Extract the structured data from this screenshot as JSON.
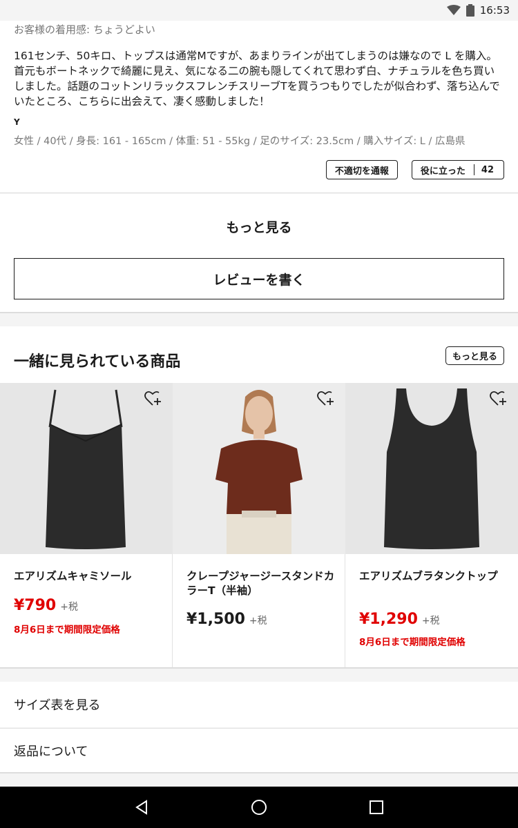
{
  "status_bar": {
    "time": "16:53"
  },
  "review": {
    "fit_label": "お客様の着用感: ちょうどよい",
    "body": "161センチ、50キロ、トップスは通常Mですが、あまりラインが出てしまうのは嫌なので L を購入。首元もボートネックで綺麗に見え、気になる二の腕も隠してくれて思わず白、ナチュラルを色ち買いしました。話題のコットンリラックスフレンチスリーブTを買うつもりでしたが似合わず、落ち込んでいたところ、こちらに出会えて、凄く感動しました！",
    "author": "Y",
    "meta": "女性 / 40代 / 身長: 161 - 165cm / 体重: 51 - 55kg / 足のサイズ: 23.5cm / 購入サイズ: L / 広島県",
    "report_label": "不適切を通報",
    "helpful_label": "役に立った",
    "helpful_count": "42"
  },
  "reviews_footer": {
    "more_label": "もっと見る",
    "write_review_label": "レビューを書く"
  },
  "related": {
    "title": "一緒に見られている商品",
    "more_label": "もっと見る",
    "products": [
      {
        "name": "エアリズムキャミソール",
        "price": "¥790",
        "tax": "+税",
        "promo": "8月6日まで期間限定価格",
        "sale": true
      },
      {
        "name": "クレープジャージースタンドカラーT（半袖）",
        "price": "¥1,500",
        "tax": "+税",
        "promo": "",
        "sale": false
      },
      {
        "name": "エアリズムブラタンクトップ",
        "price": "¥1,290",
        "tax": "+税",
        "promo": "8月6日まで期間限定価格",
        "sale": true
      }
    ]
  },
  "links": {
    "size_chart": "サイズ表を見る",
    "returns": "返品について"
  },
  "colors": {
    "sale_red": "#e00000",
    "text": "#1b1b1b",
    "nav_bg": "#000000"
  }
}
